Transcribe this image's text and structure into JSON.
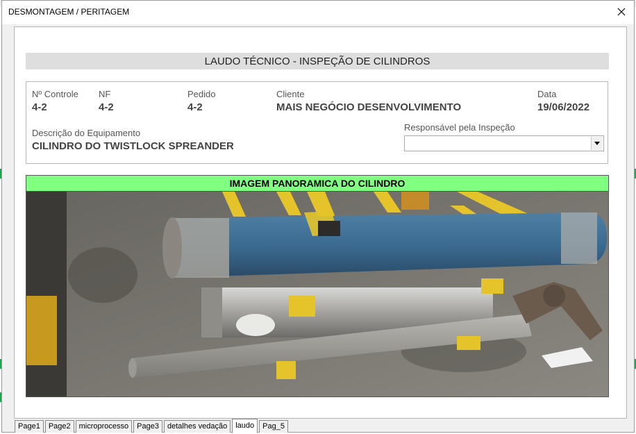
{
  "window": {
    "title": "DESMONTAGEM / PERITAGEM"
  },
  "report": {
    "title": "LAUDO TÉCNICO - INSPEÇÃO DE CILINDROS",
    "fields": {
      "controle": {
        "label": "Nº Controle",
        "value": "4-2"
      },
      "nf": {
        "label": "NF",
        "value": "4-2"
      },
      "pedido": {
        "label": "Pedido",
        "value": "4-2"
      },
      "cliente": {
        "label": "Cliente",
        "value": "MAIS NEGÓCIO DESENVOLVIMENTO"
      },
      "data": {
        "label": "Data",
        "value": "19/06/2022"
      },
      "descricao": {
        "label": "Descrição do Equipamento",
        "value": "CILINDRO DO TWISTLOCK SPREANDER"
      },
      "responsavel": {
        "label": "Responsável pela Inspeção",
        "value": ""
      }
    },
    "photo_header": "IMAGEM PANORAMICA DO CILINDRO"
  },
  "tabs": [
    {
      "label": "Page1"
    },
    {
      "label": "Page2"
    },
    {
      "label": "microprocesso"
    },
    {
      "label": "Page3"
    },
    {
      "label": "detalhes vedação"
    },
    {
      "label": "laudo"
    },
    {
      "label": "Pag_5"
    }
  ],
  "active_tab": "laudo",
  "icons": {
    "close": "close-icon",
    "dropdown": "chevron-down-icon"
  },
  "colors": {
    "photo_header_bg": "#80ff80",
    "title_bar_bg": "#dedede"
  }
}
